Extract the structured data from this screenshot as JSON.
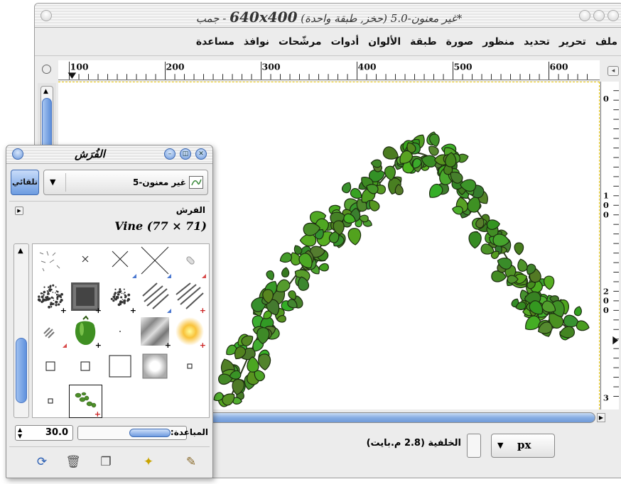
{
  "main_window": {
    "title_prefix": "*غير معنون-5.0 (حخز, طبقة واحدة) ",
    "title_size": "640x400",
    "title_suffix": " - جمب",
    "menu": [
      "ملف",
      "تحرير",
      "تحديد",
      "منظور",
      "صورة",
      "طبقة",
      "الألوان",
      "أدوات",
      "مرشّحات",
      "نوافذ",
      "مساعدة"
    ],
    "ruler": {
      "h_labels": [
        "100",
        "200",
        "300",
        "400",
        "500",
        "600"
      ],
      "v_labels": [
        "0",
        "1\n0\n0",
        "2\n0\n0",
        "3"
      ]
    },
    "status": {
      "layer_text": "الخلفية (2.8 م.بايت)",
      "unit": "px"
    }
  },
  "brushes_dialog": {
    "title": "الفُرَش",
    "auto_button": "تلقائي",
    "image_combo": "غير معنون-5",
    "tab_label": "الفرش",
    "selected_brush": "Vine (77 × 71)",
    "spacing_label": "المباعدة:",
    "spacing_value": "30.0",
    "actions": [
      "refresh-icon",
      "delete-icon",
      "duplicate-icon",
      "new-icon",
      "edit-icon"
    ]
  },
  "colors": {
    "accent_blue": "#6c9be0",
    "guide_yellow": "#e6c200",
    "leaf_green": "#5f9d2a"
  }
}
